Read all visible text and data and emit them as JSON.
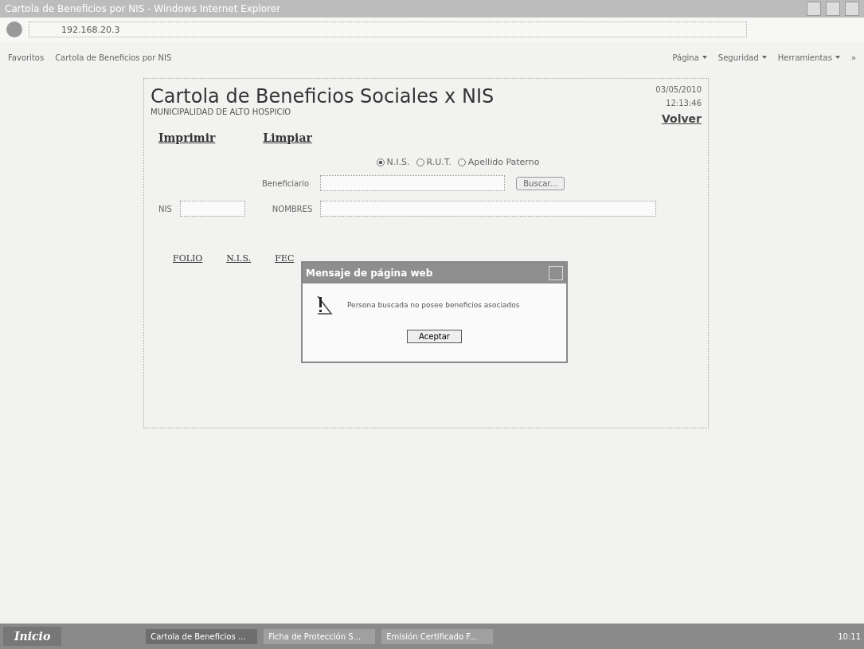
{
  "window": {
    "title": "Cartola de Beneficios por NIS - Windows Internet Explorer"
  },
  "address_bar": {
    "value": "192.168.20.3"
  },
  "favorites_bar": {
    "favorites": "Favoritos",
    "tab": "Cartola de Beneficios por NIS",
    "menus": [
      "Página",
      "Seguridad",
      "Herramientas"
    ],
    "more": "»"
  },
  "page": {
    "title": "Cartola de Beneficios Sociales x NIS",
    "subtitle": "MUNICIPALIDAD DE ALTO HOSPICIO",
    "date": "03/05/2010",
    "time": "12:13:46",
    "back_link": "Volver",
    "links": [
      "Imprimir",
      "Limpiar"
    ],
    "search_by": [
      {
        "label": "N.I.S.",
        "selected": true
      },
      {
        "label": "R.U.T.",
        "selected": false
      },
      {
        "label": "Apellido Paterno",
        "selected": false
      }
    ],
    "beneficiary_label": "Beneficiario",
    "search_button": "Buscar...",
    "nis_label": "NIS",
    "names_label": "NOMBRES",
    "columns": [
      "FOLIO",
      "N.I.S.",
      "FEC"
    ]
  },
  "dialog": {
    "title": "Mensaje de página web",
    "message": "Persona buscada no posee beneficios asociados",
    "button": "Aceptar"
  },
  "taskbar": {
    "start": "Inicio",
    "tasks": [
      {
        "label": "Cartola de Beneficios ...",
        "selected": true
      },
      {
        "label": "Ficha de Protección S...",
        "selected": false
      },
      {
        "label": "Emisión Certificado F...",
        "selected": false
      }
    ],
    "clock": "10:11"
  }
}
